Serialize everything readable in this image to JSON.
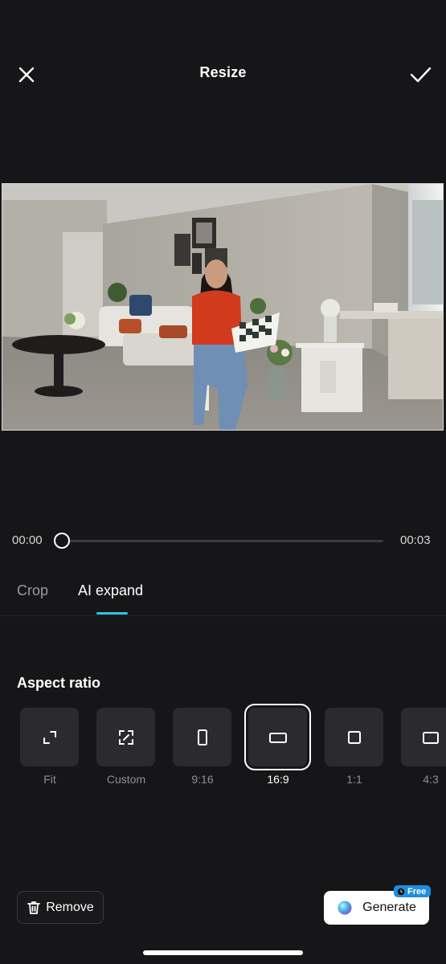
{
  "header": {
    "title": "Resize"
  },
  "timeline": {
    "start": "00:00",
    "end": "00:03",
    "progress": 0
  },
  "tabs": [
    {
      "label": "Crop",
      "active": false
    },
    {
      "label": "AI expand",
      "active": true
    }
  ],
  "aspect": {
    "heading": "Aspect ratio",
    "options": [
      {
        "label": "Fit",
        "icon": "fit-icon",
        "selected": false
      },
      {
        "label": "Custom",
        "icon": "custom-icon",
        "selected": false
      },
      {
        "label": "9:16",
        "icon": "portrait-icon",
        "selected": false
      },
      {
        "label": "16:9",
        "icon": "landscape-icon",
        "selected": true
      },
      {
        "label": "1:1",
        "icon": "square-icon",
        "selected": false
      },
      {
        "label": "4:3",
        "icon": "landscape-43-icon",
        "selected": false
      }
    ]
  },
  "actions": {
    "remove": "Remove",
    "generate": "Generate",
    "badge": "Free"
  },
  "colors": {
    "accent": "#2fc5e6",
    "background": "#161618",
    "badge": "#1d8fe0"
  }
}
